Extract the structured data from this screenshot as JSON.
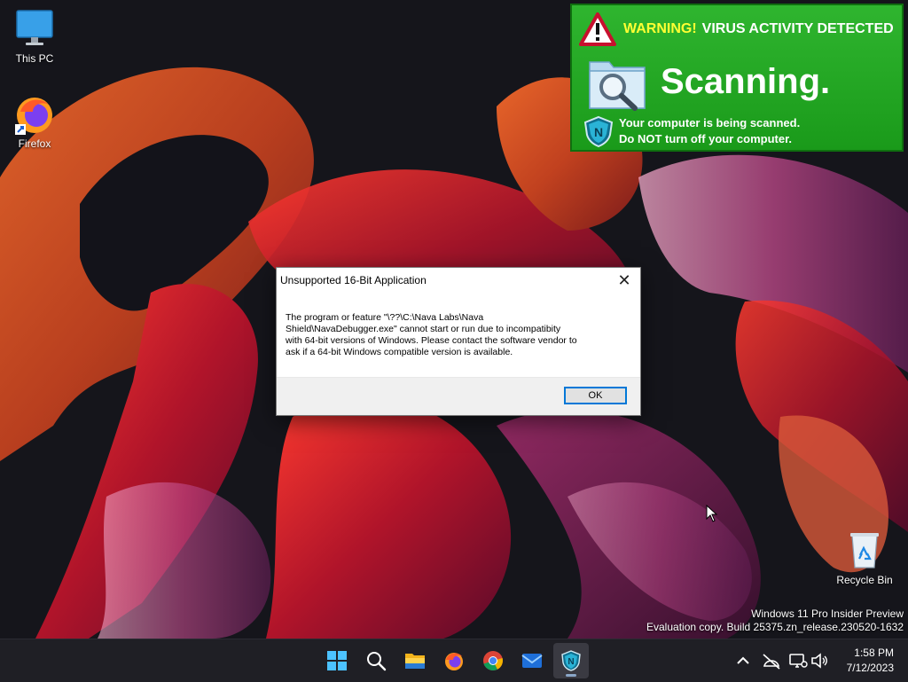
{
  "desktop": {
    "icons": [
      {
        "label": "This PC",
        "icon": "monitor-icon"
      },
      {
        "label": "Firefox",
        "icon": "firefox-icon"
      },
      {
        "label": "Recycle Bin",
        "icon": "recycle-bin-icon"
      }
    ]
  },
  "banner": {
    "warning_word": "WARNING!",
    "warning_rest": "VIRUS ACTIVITY DETECTED",
    "scanning": "Scanning.",
    "status_line1": "Your computer is being scanned.",
    "status_line2_pre": "Do",
    "status_line2_bold": "NOT",
    "status_line2_post": "turn off your computer.",
    "colors": {
      "background": "#22aa22",
      "warning_word": "#ffff33"
    }
  },
  "dialog": {
    "title": "Unsupported 16-Bit Application",
    "message_lines": [
      "The program or feature \"\\??\\C:\\Nava Labs\\Nava",
      "Shield\\NavaDebugger.exe\" cannot start or run due to incompatibity",
      "with 64-bit versions of Windows. Please contact the software vendor to",
      "ask if a 64-bit Windows compatible version is available."
    ],
    "ok_label": "OK",
    "close_glyph": "✕"
  },
  "watermark": {
    "line1": "Windows 11 Pro Insider Preview",
    "line2": "Evaluation copy. Build 25375.zn_release.230520-1632"
  },
  "taskbar": {
    "apps": [
      "start-icon",
      "search-icon",
      "file-explorer-icon",
      "firefox-icon",
      "chrome-icon",
      "mail-icon",
      "nava-shield-icon"
    ],
    "active_app": "nava-shield-icon",
    "tray_icons": [
      "chevron-up-icon",
      "network-offline-icon",
      "display-icon",
      "speaker-icon"
    ],
    "time": "1:58 PM",
    "date": "7/12/2023"
  }
}
